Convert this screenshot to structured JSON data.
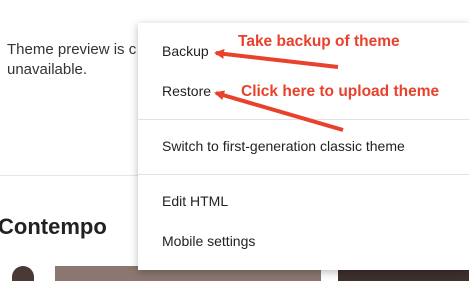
{
  "preview": {
    "message": "Theme preview is c\nunavailable."
  },
  "theme": {
    "name": "Contempo"
  },
  "menu": {
    "items": [
      {
        "id": "backup",
        "label": "Backup"
      },
      {
        "id": "restore",
        "label": "Restore"
      },
      {
        "id": "switch-classic",
        "label": "Switch to first-generation classic theme"
      },
      {
        "id": "edit-html",
        "label": "Edit HTML"
      },
      {
        "id": "mobile-settings",
        "label": "Mobile settings"
      }
    ]
  },
  "annotations": {
    "backup": "Take backup of theme",
    "restore": "Click here to upload theme",
    "color": "#e8412c"
  }
}
